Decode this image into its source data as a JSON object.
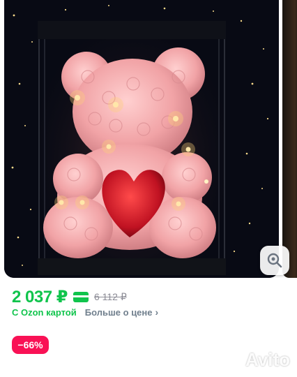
{
  "gallery": {
    "zoom_icon": "search-zoom-icon",
    "photo_description_icon": "rose-teddy-bear-photo"
  },
  "price": {
    "current": "2 037 ₽",
    "old": "6 112 ₽",
    "card_icon": "green-card-icon"
  },
  "sub": {
    "ozon_card": "С Ozon картой",
    "more": "Больше о цене",
    "chevron_icon": "chevron-right-icon"
  },
  "discount": "−66%",
  "watermark": "Avito",
  "colors": {
    "price_green": "#10c44c",
    "discount_pink": "#f91155",
    "muted": "#8c8c96"
  }
}
